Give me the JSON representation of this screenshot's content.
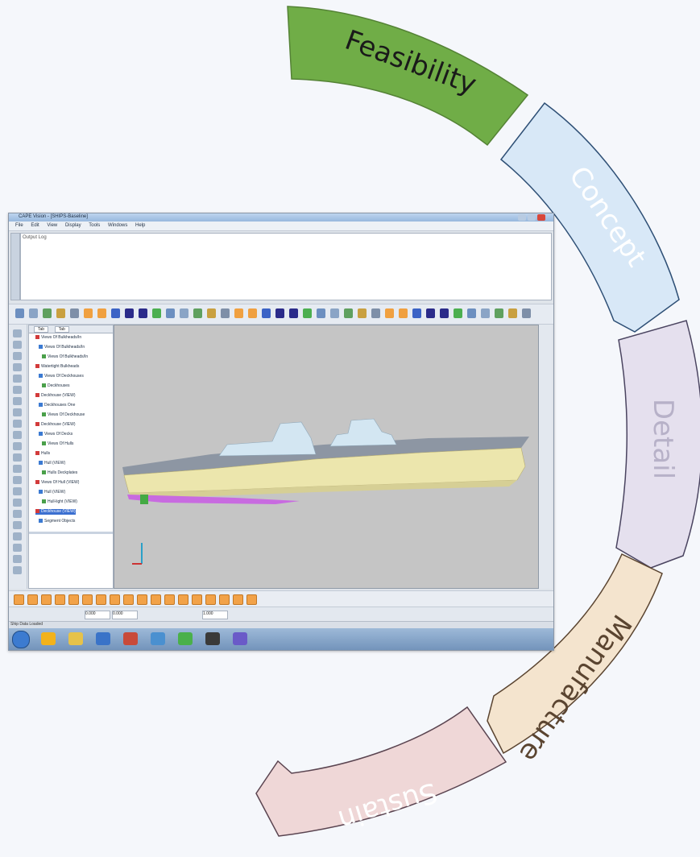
{
  "stages": [
    {
      "label": "Feasibility",
      "fill": "#70ad47",
      "stroke": "#548235",
      "text_color": "#1a1a1a"
    },
    {
      "label": "Concept",
      "fill": "#d8e8f7",
      "stroke": "#2e4f75",
      "text_color": "#ffffff"
    },
    {
      "label": "Detail",
      "fill": "#e5e0ee",
      "stroke": "#4a4460",
      "text_color": "#b7b1c8"
    },
    {
      "label": "Manufacture",
      "fill": "#f4e4ce",
      "stroke": "#5a4430",
      "text_color": "#5a4430"
    },
    {
      "label": "Sustain",
      "fill": "#efd7d7",
      "stroke": "#5a4450",
      "text_color": "#ffffff"
    }
  ],
  "app": {
    "title": "CAPE Vision - [SHIPS-Baseline]",
    "menu": [
      "File",
      "Edit",
      "View",
      "Display",
      "Tools",
      "Windows",
      "Help"
    ],
    "output_label": "Output Log",
    "tree_tabs": [
      "Tab",
      "Tab"
    ],
    "tree_items": [
      {
        "text": "Views Of Bulkheads/In",
        "selected": false
      },
      {
        "text": "Views Of Bulkheads/In",
        "selected": false
      },
      {
        "text": "Views Of Bulkheads/In",
        "selected": false
      },
      {
        "text": "Watertight Bulkheads",
        "selected": false
      },
      {
        "text": "Views Of Deckhouses",
        "selected": false
      },
      {
        "text": "Deckhouses",
        "selected": false
      },
      {
        "text": "Deckhouse (VIEW)",
        "selected": false
      },
      {
        "text": "Deckhouses One",
        "selected": false
      },
      {
        "text": "Views Of Deckhouse",
        "selected": false
      },
      {
        "text": "Deckhouse (VIEW)",
        "selected": false
      },
      {
        "text": "Views Of Decks",
        "selected": false
      },
      {
        "text": "Views Of Hulls",
        "selected": false
      },
      {
        "text": "Hulls",
        "selected": false
      },
      {
        "text": "Hull (VIEW)",
        "selected": false
      },
      {
        "text": "Hulls Deckplates",
        "selected": false
      },
      {
        "text": "Views Of Hull (VIEW)",
        "selected": false
      },
      {
        "text": "Hull (VIEW)",
        "selected": false
      },
      {
        "text": "Hull-light (VIEW)",
        "selected": false
      },
      {
        "text": "Deckhouse (VIEW)",
        "selected": true
      },
      {
        "text": "Segment Objects",
        "selected": false
      }
    ],
    "status_text": "Ship Data Loaded",
    "coord_x": "0.000",
    "coord_y": "0.000",
    "zoom": "1.000"
  }
}
